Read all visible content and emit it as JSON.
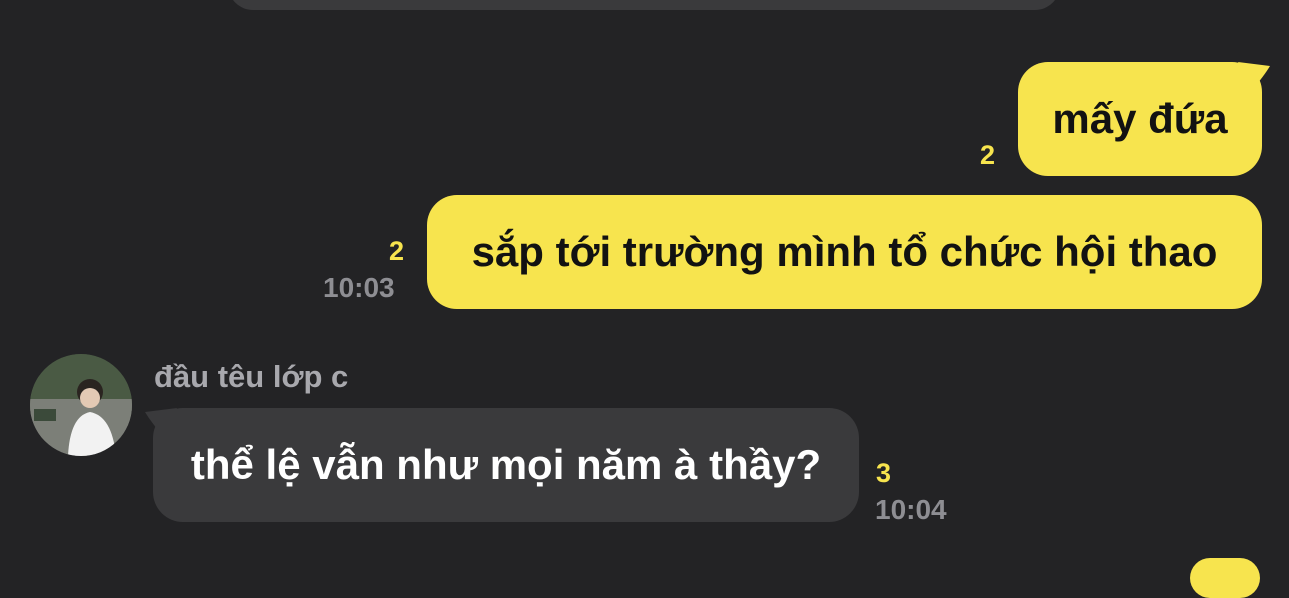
{
  "messages": [
    {
      "direction": "outgoing",
      "text": "mấy đứa",
      "unread": "2"
    },
    {
      "direction": "outgoing",
      "text": "sắp tới trường mình tổ chức hội thao",
      "unread": "2",
      "time": "10:03"
    },
    {
      "direction": "incoming",
      "sender": "đầu têu lớp c",
      "text": "thể lệ vẫn như mọi năm à thầy?",
      "unread": "3",
      "time": "10:04"
    }
  ],
  "colors": {
    "background": "#232325",
    "outgoing_bubble": "#f7e44e",
    "incoming_bubble": "#3a3a3c",
    "unread": "#f7e44e",
    "time": "#8e8e93"
  }
}
